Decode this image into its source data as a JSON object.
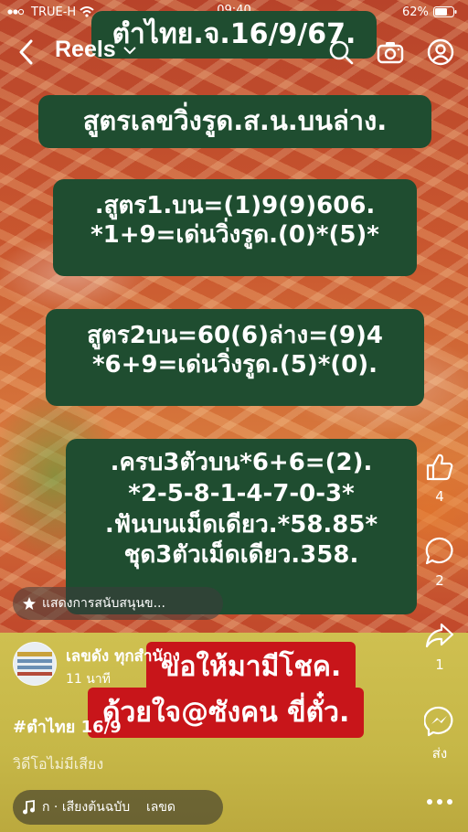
{
  "status_bar": {
    "carrier": "TRUE-H",
    "time": "09:40",
    "battery": "62%"
  },
  "header": {
    "title": "Reels"
  },
  "overlay": {
    "title": "ตำไทย.จ.16/9/67.",
    "heading": "สูตรเลขวิ่งรูด.ส.น.บนล่าง.",
    "box1": [
      ".สูตร1.บน=(1)9(9)606.",
      "*1+9=เด่นวิ่งรูด.(0)*(5)*"
    ],
    "box2": [
      "สูตร2บน=60(6)ล่าง=(9)4",
      "*6+9=เด่นวิ่งรูด.(5)*(0)."
    ],
    "box3": [
      ".ครบ3ตัวบน*6+6=(2).",
      "*2-5-8-1-4-7-0-3*",
      ".ฟันบนเม็ดเดียว.*58.85*",
      "ชุด3ตัวเม็ดเดียว.358."
    ],
    "banner1": "ขอให้มามีโชค.",
    "banner2": "ด้วยใจ@ซังคน ขี่ตั๋ว."
  },
  "actions": {
    "likes": "4",
    "comments": "2",
    "shares": "1",
    "send_label": "ส่ง"
  },
  "post": {
    "support_text": "แสดงการสนับสนุนข...",
    "author": "เลขดัง ทุกสำนักง",
    "time": "11 นาที",
    "caption": "#ตำไทย 16/9",
    "no_audio": "วิดีโอไม่มีเสียง",
    "audio": "ก · เสียงต้นฉบับ    เลขด"
  }
}
